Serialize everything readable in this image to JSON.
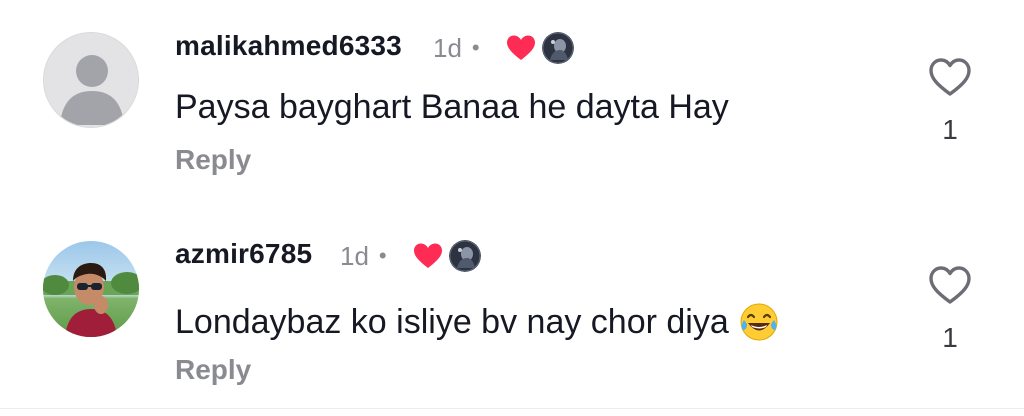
{
  "comments": [
    {
      "username": "malikahmed6333",
      "time": "1d",
      "separator": "•",
      "text": "Paysa bayghart Banaa he dayta Hay",
      "reply_label": "Reply",
      "like_count": "1",
      "avatar": "default-avatar-icon",
      "liked_by_creator": true
    },
    {
      "username": "azmir6785",
      "time": "1d",
      "separator": "•",
      "text": "Londaybaz ko isliye bv nay chor diya",
      "emoji": "laughing-tears-emoji",
      "reply_label": "Reply",
      "like_count": "1",
      "avatar": "user-photo",
      "liked_by_creator": true
    }
  ],
  "colors": {
    "heart": "#fe2c55",
    "muted_text": "#8a8b91",
    "primary_text": "#161823"
  }
}
